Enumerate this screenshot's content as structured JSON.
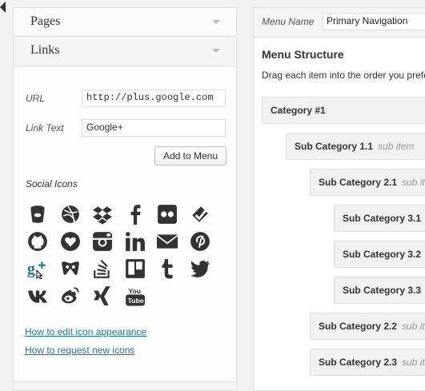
{
  "left_panel": {
    "pages_title": "Pages",
    "links_title": "Links",
    "url_label": "URL",
    "url_value": "http://plus.google.com",
    "link_text_label": "Link Text",
    "link_text_value": "Google+",
    "add_button": "Add to Menu",
    "social_icons_label": "Social Icons",
    "icons": [
      "bucket-icon",
      "dribbble-icon",
      "dropbox-icon",
      "facebook-icon",
      "flickr-icon",
      "foursquare-icon",
      "github-icon",
      "heart-icon",
      "instagram-icon",
      "linkedin-icon",
      "mail-icon",
      "pinterest-icon",
      "googleplus-icon",
      "wufoo-icon",
      "stackoverflow-icon",
      "trello-icon",
      "tumblr-icon",
      "twitter-icon",
      "vk-icon",
      "weibo-icon",
      "xing-icon",
      "youtube-icon"
    ],
    "help_link_1": "How to edit icon appearance",
    "help_link_2": "How to request new icons"
  },
  "right_panel": {
    "menu_name_label": "Menu Name",
    "menu_name_value": "Primary Navigation",
    "structure_title": "Menu Structure",
    "structure_desc": "Drag each item into the order you prefe",
    "items": [
      {
        "name": "Category #1",
        "type": ""
      },
      {
        "name": "Sub Category 1.1",
        "type": "sub item"
      },
      {
        "name": "Sub Category 2.1",
        "type": "sub it"
      },
      {
        "name": "Sub Category 3.1",
        "type": ""
      },
      {
        "name": "Sub Category 3.2",
        "type": ""
      },
      {
        "name": "Sub Category 3.3",
        "type": ""
      },
      {
        "name": "Sub Category 2.2",
        "type": "sub it"
      },
      {
        "name": "Sub Category 2.3",
        "type": "sub it"
      }
    ]
  },
  "colors": {
    "icon": "#333333",
    "icon_active": "#21759b",
    "link": "#21759b"
  }
}
